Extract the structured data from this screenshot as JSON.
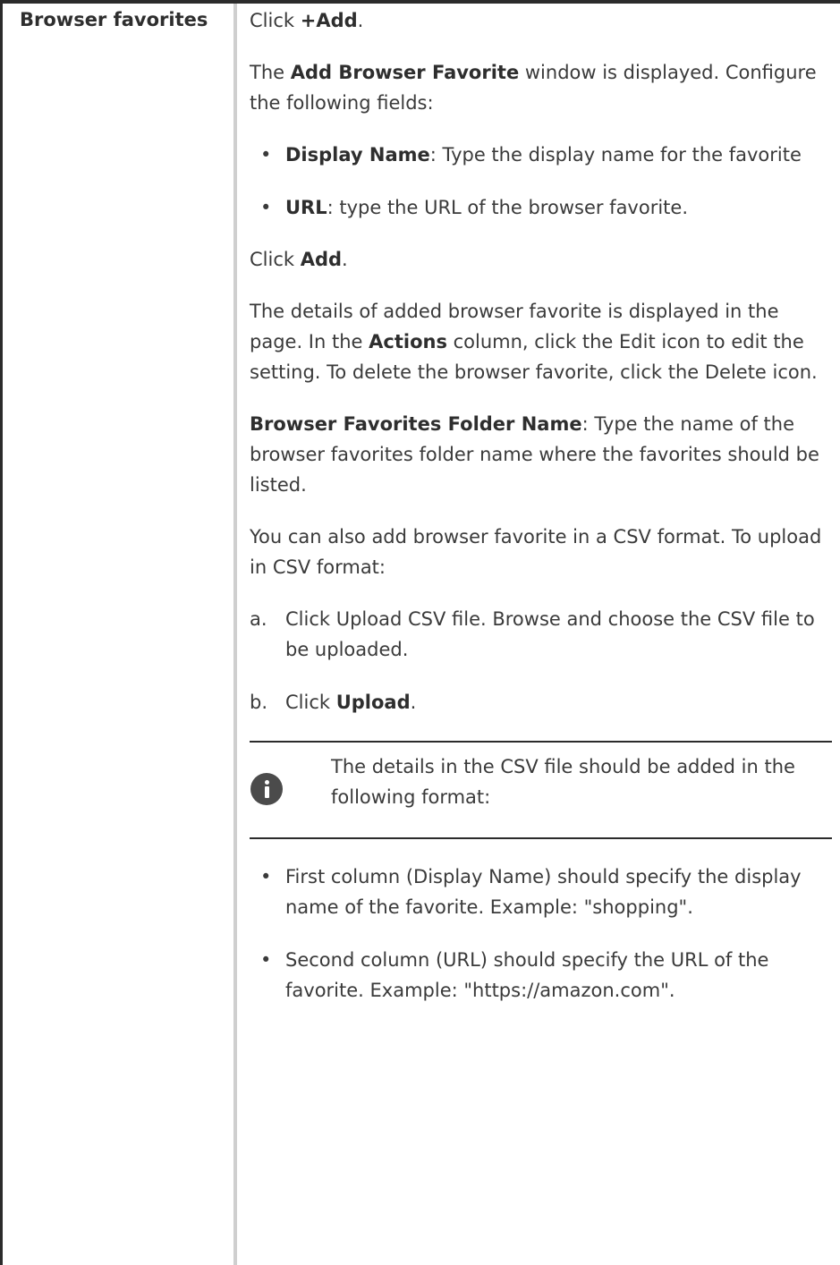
{
  "row": {
    "term": "Browser favorites"
  },
  "content": {
    "add_prefix": "Click ",
    "add_bold": "+Add",
    "add_suffix": ".",
    "window_prefix": "The ",
    "window_bold": "Add Browser Favorite",
    "window_suffix": " window is displayed. Configure the following fields:",
    "fields": [
      {
        "name": "Display Name",
        "text": ": Type the display name for the favorite"
      },
      {
        "name": "URL",
        "text": ": type the URL of the browser favorite."
      }
    ],
    "click_prefix": "Click ",
    "click_bold": "Add",
    "click_suffix": ".",
    "details_prefix": "The details of added browser favorite is displayed in the page. In the ",
    "details_bold": "Actions",
    "details_suffix": " column, click the Edit icon to edit the setting. To delete the browser favorite, click the Delete icon.",
    "folder_bold": "Browser Favorites Folder Name",
    "folder_suffix": ": Type the name of the browser favorites folder name where the favorites should be listed.",
    "csv_intro": "You can also add browser favorite in a CSV format. To upload in CSV format:",
    "steps": [
      {
        "marker": "a.",
        "text": "Click Upload CSV file. Browse and choose the CSV file to be uploaded.",
        "bold": "",
        "suffix": ""
      },
      {
        "marker": "b.",
        "text": "Click ",
        "bold": "Upload",
        "suffix": "."
      }
    ],
    "note": {
      "icon": "info-icon",
      "text": "The details in the CSV file should be added in the following format:"
    },
    "csv_rules": [
      "First column (Display Name) should specify the display name of the favorite. Example: \"shopping\".",
      "Second column (URL) should specify the URL of the favorite. Example: \"https://amazon.com\"."
    ]
  }
}
